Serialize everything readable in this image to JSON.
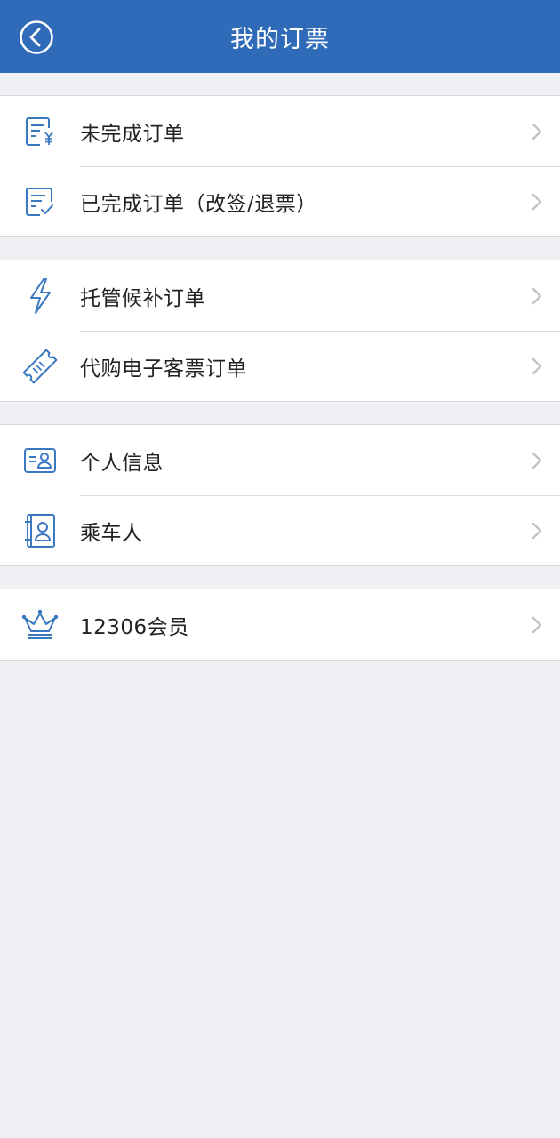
{
  "header": {
    "title": "我的订票"
  },
  "groups": [
    {
      "items": [
        {
          "label": "未完成订单",
          "icon": "pending-order-icon"
        },
        {
          "label": "已完成订单（改签/退票）",
          "icon": "completed-order-icon"
        }
      ]
    },
    {
      "items": [
        {
          "label": "托管候补订单",
          "icon": "lightning-icon"
        },
        {
          "label": "代购电子客票订单",
          "icon": "ticket-icon"
        }
      ]
    },
    {
      "items": [
        {
          "label": "个人信息",
          "icon": "id-card-icon"
        },
        {
          "label": "乘车人",
          "icon": "passenger-icon"
        }
      ]
    },
    {
      "items": [
        {
          "label": "12306会员",
          "icon": "crown-icon"
        }
      ]
    }
  ],
  "colors": {
    "header_bg": "#2f6bb8",
    "icon_blue": "#3a78c2",
    "page_bg": "#efeff4"
  }
}
